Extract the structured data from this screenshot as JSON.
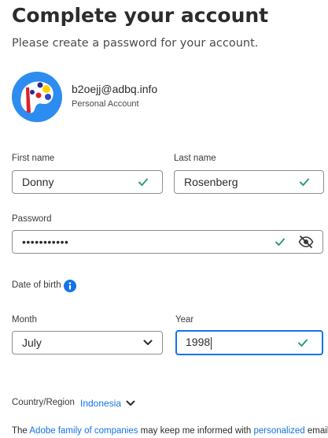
{
  "header": {
    "title": "Complete your account",
    "subtitle": "Please create a password for your account."
  },
  "account": {
    "email": "b2oejj@adbq.info",
    "type": "Personal Account",
    "avatar_icon": "palette-avatar-icon"
  },
  "form": {
    "first_name": {
      "label": "First name",
      "value": "Donny",
      "valid": true
    },
    "last_name": {
      "label": "Last name",
      "value": "Rosenberg",
      "valid": true
    },
    "password": {
      "label": "Password",
      "value": "•••••••••••",
      "valid": true,
      "toggle_icon": "eye-slash-icon"
    },
    "dob": {
      "label": "Date of birth",
      "info_icon": "info-icon"
    },
    "month": {
      "label": "Month",
      "value": "July"
    },
    "year": {
      "label": "Year",
      "value": "1998",
      "valid": true
    }
  },
  "country": {
    "label": "Country/Region",
    "value": "Indonesia"
  },
  "legal": {
    "part1": "The ",
    "link1": "Adobe family of companies",
    "part2": " may keep me informed with ",
    "link2": "personalized",
    "part3": " emails"
  },
  "colors": {
    "accent": "#1473e6",
    "valid": "#2d9d78",
    "text": "#2c2c2c"
  }
}
